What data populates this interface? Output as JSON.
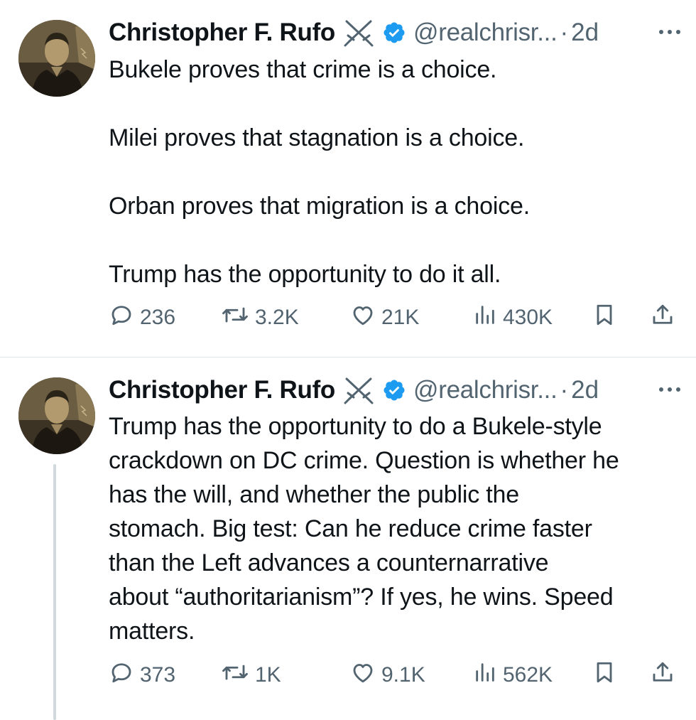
{
  "tweets": [
    {
      "author": {
        "name": "Christopher F. Rufo",
        "handle": "@realchrisr...",
        "time": "2d",
        "separator": "·"
      },
      "paragraphs": [
        "Bukele proves that crime is a choice.",
        "Milei proves that stagnation is a choice.",
        "Orban proves that migration is a choice.",
        "Trump has the opportunity to do it all."
      ],
      "stats": {
        "replies": "236",
        "retweets": "3.2K",
        "likes": "21K",
        "views": "430K"
      }
    },
    {
      "author": {
        "name": "Christopher F. Rufo",
        "handle": "@realchrisr...",
        "time": "2d",
        "separator": "·"
      },
      "lines": [
        "Trump has the opportunity to do a Bukele-style",
        "crackdown on DC crime. Question is whether he",
        "has the will, and whether the public the",
        "stomach. Big test: Can he reduce crime faster",
        "than the Left advances a counternarrative",
        "about “authoritarianism”? If yes, he wins. Speed",
        "matters."
      ],
      "stats": {
        "replies": "373",
        "retweets": "1K",
        "likes": "9.1K",
        "views": "562K"
      }
    }
  ],
  "icons": {
    "author_badge": "crossed-swords-icon",
    "verified": "verified-badge-icon",
    "more": "more-options-icon",
    "reply": "reply-icon",
    "retweet": "retweet-icon",
    "like": "heart-icon",
    "views": "views-icon",
    "bookmark": "bookmark-icon",
    "share": "share-icon"
  },
  "colors": {
    "text": "#0f1419",
    "secondary": "#536471",
    "verified": "#1d9bf0",
    "thread_line": "#cfd9de",
    "divider": "#e1e6ea"
  }
}
